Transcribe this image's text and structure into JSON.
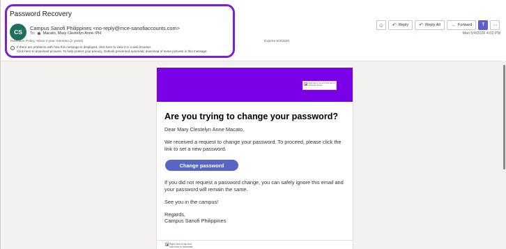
{
  "header": {
    "subject": "Password Recovery",
    "avatar_initials": "CS",
    "sender": "Campus Sanofi Philippines <no-reply@mce-sanofiaccounts.com>",
    "to_label": "To:",
    "recipient": "Macato, Mary Clestelyn Anne /PH",
    "retention": "Retention Policy: Inbox 2-year retention (2 years)",
    "expires": "Expires 5/3/2028",
    "info_line1": "If there are problems with how this message is displayed, click here to view it in a web browser.",
    "info_line2": "Click here to download pictures. To help protect your privacy, Outlook prevented automatic download of some pictures in this message.",
    "datetime": "Mon 5/4/2026 4:02 PM"
  },
  "toolbar": {
    "reply": "Reply",
    "reply_all": "Reply All",
    "forward": "Forward"
  },
  "email": {
    "banner_image_text": "Right-click or tap and hold here to download pictures.",
    "heading": "Are you trying to change your password?",
    "greeting": "Dear Mary Clestelyn Anne Macato,",
    "para1_line1": "We received a request to change your password. To proceed, please click the",
    "para1_line2": "link to set a new password.",
    "cta": "Change password",
    "para2_line1": "If you did not request a password change, you can safely ignore this email and",
    "para2_line2": "your password will remain the same.",
    "para3": "See you in the campus!",
    "signoff": "Regards,",
    "signature": "Campus Sanofi Philippines",
    "footer_image_line1": "Right-click or tap and",
    "footer_image_line2": "hold here to download"
  },
  "colors": {
    "highlight": "#7a1fd1",
    "banner": "#7a00e6",
    "button": "#5865c4",
    "avatar": "#1e6f5c"
  },
  "icons": [
    "emoji-icon",
    "reply-icon",
    "reply-all-icon",
    "forward-icon",
    "teams-icon",
    "more-icon",
    "info-icon",
    "broken-image-icon"
  ]
}
